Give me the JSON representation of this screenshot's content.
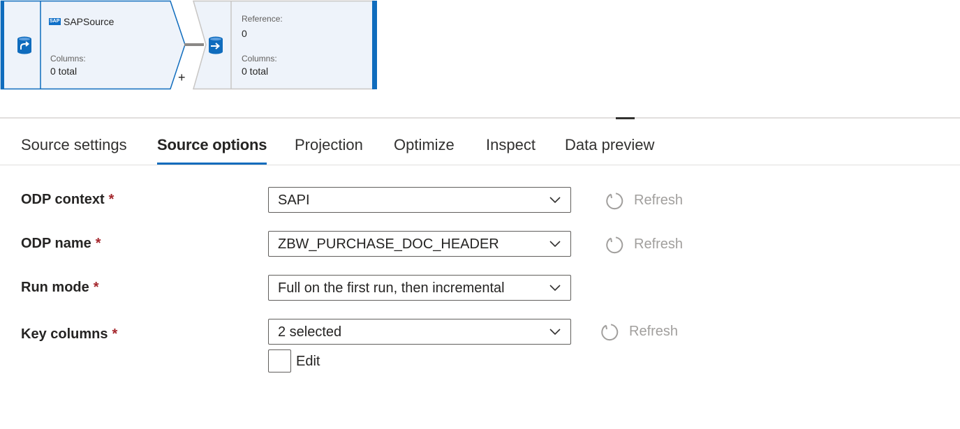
{
  "flow": {
    "source_node": {
      "title": "SAPSource",
      "logo_text": "SAP",
      "columns_label": "Columns:",
      "columns_value": "0 total",
      "icon": "database-source-icon"
    },
    "add_button_label": "+",
    "sink_node": {
      "reference_label": "Reference:",
      "reference_value": "0",
      "columns_label": "Columns:",
      "columns_value": "0 total",
      "icon": "database-sink-icon"
    },
    "accent_color": "#0f6cbd"
  },
  "tabs": [
    {
      "label": "Source settings",
      "active": false
    },
    {
      "label": "Source options",
      "active": true
    },
    {
      "label": "Projection",
      "active": false
    },
    {
      "label": "Optimize",
      "active": false
    },
    {
      "label": "Inspect",
      "active": false
    },
    {
      "label": "Data preview",
      "active": false
    }
  ],
  "form": {
    "odp_context": {
      "label": "ODP context",
      "required": "*",
      "value": "SAPI",
      "refresh_label": "Refresh"
    },
    "odp_name": {
      "label": "ODP name",
      "required": "*",
      "value": "ZBW_PURCHASE_DOC_HEADER",
      "refresh_label": "Refresh"
    },
    "run_mode": {
      "label": "Run mode",
      "required": "*",
      "value": "Full on the first run, then incremental"
    },
    "key_columns": {
      "label": "Key columns",
      "required": "*",
      "value": "2 selected",
      "refresh_label": "Refresh"
    },
    "edit_checkbox": {
      "label": "Edit",
      "checked": false
    }
  },
  "colors": {
    "required": "#a4262c",
    "tab_underline": "#0f6cbd",
    "disabled_text": "#a19f9d",
    "node_fill": "#eef3fa"
  }
}
